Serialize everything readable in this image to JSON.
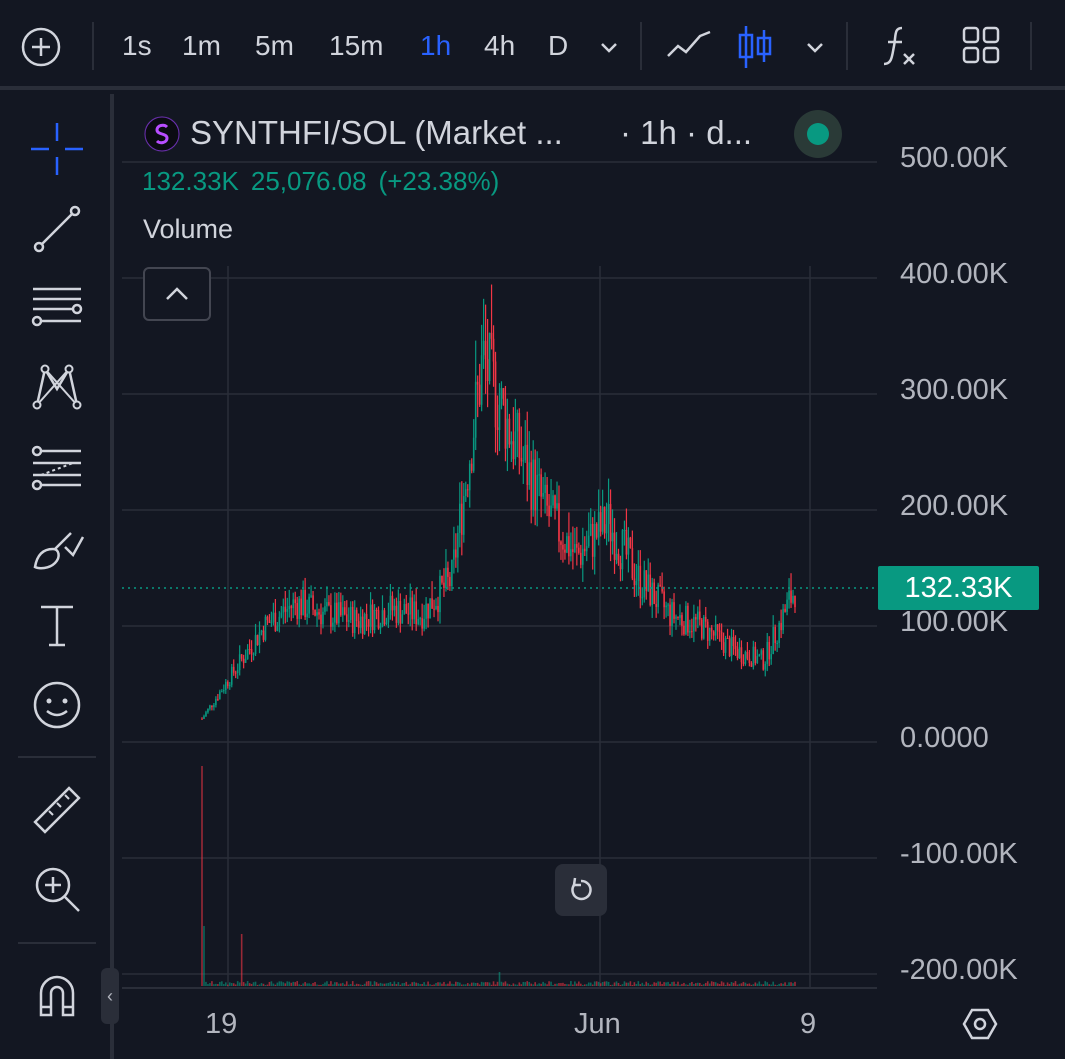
{
  "toolbar": {
    "intervals": [
      {
        "label": "1s",
        "active": false
      },
      {
        "label": "1m",
        "active": false
      },
      {
        "label": "5m",
        "active": false
      },
      {
        "label": "15m",
        "active": false
      },
      {
        "label": "1h",
        "active": true
      },
      {
        "label": "4h",
        "active": false
      },
      {
        "label": "D",
        "active": false
      }
    ],
    "icons": [
      "add-symbol-icon",
      "interval-dropdown-icon",
      "line-chart-icon",
      "candlestick-icon",
      "chart-type-dropdown-icon",
      "indicators-icon",
      "layout-icon"
    ]
  },
  "sidebar": {
    "tools": [
      "crosshair-icon",
      "trend-line-icon",
      "horizontal-lines-icon",
      "pattern-icon",
      "fib-icon",
      "brush-icon",
      "text-icon",
      "emoji-icon",
      "ruler-icon",
      "zoom-in-icon",
      "magnet-icon"
    ],
    "collapse_label": "‹"
  },
  "legend": {
    "symbol": "SYNTHFI/SOL (Market ...",
    "interval": "· 1h · d...",
    "status_color": "#089981",
    "ohlc": {
      "last": "132.33K",
      "change": "25,076.08",
      "change_pct": "(+23.38%)"
    },
    "volume_label": "Volume"
  },
  "price_axis": {
    "labels": [
      "500.00K",
      "400.00K",
      "300.00K",
      "200.00K",
      "100.00K",
      "0.0000",
      "-100.00K",
      "-200.00K"
    ],
    "last_price": "132.33K",
    "last_price_color": "#089981"
  },
  "time_axis": {
    "labels": [
      "19",
      "Jun",
      "9"
    ]
  },
  "colors": {
    "up": "#089981",
    "down": "#f23645",
    "background": "#131722",
    "grid": "#2a2e39",
    "accent": "#2962ff"
  },
  "chart_data": {
    "type": "candlestick",
    "interval": "1h",
    "symbol": "SYNTHFI/SOL",
    "ylim": [
      -200000,
      500000
    ],
    "yticks": [
      500000,
      400000,
      300000,
      200000,
      100000,
      0,
      -100000,
      -200000
    ],
    "last_price": 132330,
    "x_ticks": [
      "19",
      "Jun",
      "9"
    ],
    "price_path": [
      {
        "x": "19",
        "close": 20000
      },
      {
        "x": "19",
        "close": 60000
      },
      {
        "x": "19",
        "close": 100000
      },
      {
        "x": "19",
        "close": 120000
      },
      {
        "x": "19",
        "close": 110000
      },
      {
        "x": "19",
        "close": 105000
      },
      {
        "x": "19",
        "close": 115000
      },
      {
        "x": "19",
        "close": 110000
      },
      {
        "x": "19",
        "close": 140000
      },
      {
        "x": "19",
        "close": 330000
      },
      {
        "x": "19",
        "close": 260000
      },
      {
        "x": "19",
        "close": 200000
      },
      {
        "x": "Jun",
        "close": 160000
      },
      {
        "x": "Jun",
        "close": 190000
      },
      {
        "x": "Jun",
        "close": 140000
      },
      {
        "x": "Jun",
        "close": 110000
      },
      {
        "x": "Jun",
        "close": 100000
      },
      {
        "x": "Jun",
        "close": 80000
      },
      {
        "x": "9",
        "close": 70000
      },
      {
        "x": "9",
        "close": 132330
      }
    ],
    "volume_spikes": "early spike near 19, minor spikes afterwards"
  }
}
